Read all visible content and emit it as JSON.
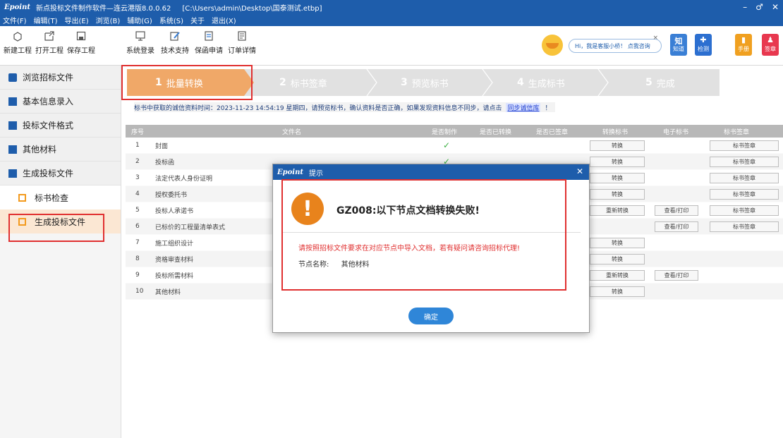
{
  "window": {
    "logo": "Epoint",
    "title": "新点投标文件制作软件—连云港版8.0.0.62",
    "path": "[C:\\Users\\admin\\Desktop\\国泰测试.etbp]",
    "controls": [
      "–",
      "♂",
      "✕"
    ]
  },
  "menu": [
    "文件(F)",
    "编辑(T)",
    "导出(E)",
    "浏览(B)",
    "辅助(G)",
    "系统(S)",
    "关于",
    "退出(X)"
  ],
  "toolbar": {
    "left": [
      {
        "label": "新建工程",
        "icon": "new-project-icon"
      },
      {
        "label": "打开工程",
        "icon": "open-project-icon"
      },
      {
        "label": "保存工程",
        "icon": "save-project-icon"
      },
      {
        "label": "系统登录",
        "icon": "login-icon"
      },
      {
        "label": "技术支持",
        "icon": "support-icon"
      },
      {
        "label": "保函申请",
        "icon": "guarantee-icon"
      },
      {
        "label": "订单详情",
        "icon": "order-icon"
      }
    ],
    "assistant_text": "Hi，我是客服小桥！ 点我咨询",
    "right": [
      {
        "label": "知道",
        "glyph": "知",
        "color": "#3a7fd5"
      },
      {
        "label": "检测",
        "glyph": "✚",
        "color": "#2c6fd0"
      },
      {
        "label": "手册",
        "glyph": "▮",
        "color": "#f0a020"
      },
      {
        "label": "签章",
        "glyph": "♟",
        "color": "#e8384f"
      }
    ]
  },
  "sidebar": {
    "items": [
      "浏览招标文件",
      "基本信息录入",
      "投标文件格式",
      "其他材料",
      "生成投标文件"
    ],
    "subitems": [
      "标书检查",
      "生成投标文件"
    ]
  },
  "steps": [
    {
      "num": "1",
      "label": "批量转换",
      "active": true
    },
    {
      "num": "2",
      "label": "标书签章",
      "active": false
    },
    {
      "num": "3",
      "label": "预览标书",
      "active": false
    },
    {
      "num": "4",
      "label": "生成标书",
      "active": false
    },
    {
      "num": "5",
      "label": "完成",
      "active": false
    }
  ],
  "notice": {
    "text": "标书中获取的诚信资料时间：2023-11-23 14:54:19 星期四，请预览标书，确认资料是否正确，如果发现资料信息不同步，请点击",
    "link": "同步诚信库",
    "tail": "！"
  },
  "table": {
    "headers": [
      "序号",
      "文件名",
      "是否制作",
      "是否已转换",
      "是否已签章",
      "转换标书",
      "电子标书",
      "标书签章"
    ],
    "rows": [
      {
        "no": "1",
        "name": "封面",
        "made": true,
        "convert": "转换",
        "ebook": "",
        "sign": "标书签章"
      },
      {
        "no": "2",
        "name": "投标函",
        "made": true,
        "convert": "转换",
        "ebook": "",
        "sign": "标书签章"
      },
      {
        "no": "3",
        "name": "法定代表人身份证明",
        "made": false,
        "convert": "转换",
        "ebook": "",
        "sign": "标书签章"
      },
      {
        "no": "4",
        "name": "授权委托书",
        "made": false,
        "convert": "转换",
        "ebook": "",
        "sign": "标书签章"
      },
      {
        "no": "5",
        "name": "投标人承诺书",
        "made": false,
        "convert": "重新转换",
        "ebook": "查看/打印",
        "sign": "标书签章"
      },
      {
        "no": "6",
        "name": "已标价的工程量清单表式",
        "made": false,
        "convert": "",
        "ebook": "查看/打印",
        "sign": "标书签章"
      },
      {
        "no": "7",
        "name": "施工组织设计",
        "made": false,
        "convert": "转换",
        "ebook": "",
        "sign": ""
      },
      {
        "no": "8",
        "name": "资格审查材料",
        "made": false,
        "convert": "转换",
        "ebook": "",
        "sign": ""
      },
      {
        "no": "9",
        "name": "投标所需材料",
        "made": false,
        "convert": "重新转换",
        "ebook": "查看/打印",
        "sign": ""
      },
      {
        "no": "10",
        "name": "其他材料",
        "made": false,
        "convert": "转换",
        "ebook": "",
        "sign": ""
      }
    ]
  },
  "dialog": {
    "logo": "Epoint",
    "title": "提示",
    "close": "✕",
    "icon_glyph": "!",
    "heading": "GZ008:以下节点文档转换失败!",
    "message": "请按照招标文件要求在对应节点中导入文档，若有疑问请咨询招标代理!",
    "node_label": "节点名称:",
    "node_value": "其他材料",
    "ok": "确定"
  },
  "colors": {
    "brand": "#1e5dab",
    "active_step": "#f0a868",
    "highlight": "#e03030",
    "check": "#3cb043"
  }
}
